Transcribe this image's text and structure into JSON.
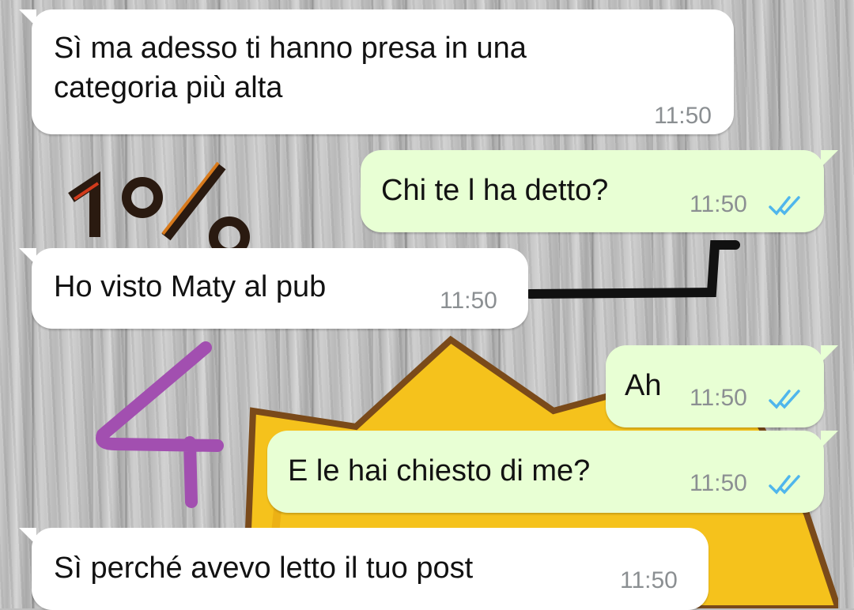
{
  "messages": [
    {
      "direction": "incoming",
      "text": "Sì ma adesso ti hanno presa in una\ncategoria più alta",
      "time": "11:50"
    },
    {
      "direction": "outgoing",
      "text": "Chi te l ha detto?",
      "time": "11:50",
      "status": "read"
    },
    {
      "direction": "incoming",
      "text": "Ho visto Maty al pub",
      "time": "11:50"
    },
    {
      "direction": "outgoing",
      "text": "Ah",
      "time": "11:50",
      "status": "read"
    },
    {
      "direction": "outgoing",
      "text": "E le hai chiesto di me?",
      "time": "11:50",
      "status": "read"
    },
    {
      "direction": "incoming",
      "text": "Sì perché avevo letto il tuo post",
      "time": "11:50"
    }
  ],
  "colors": {
    "incoming_bubble": "#ffffff",
    "outgoing_bubble": "#e8ffd4",
    "read_ticks": "#4fb6ec",
    "timestamp": "#8b8f92",
    "annotation": "#a24fb0"
  },
  "icons": {
    "read_status": "double-check-icon"
  }
}
